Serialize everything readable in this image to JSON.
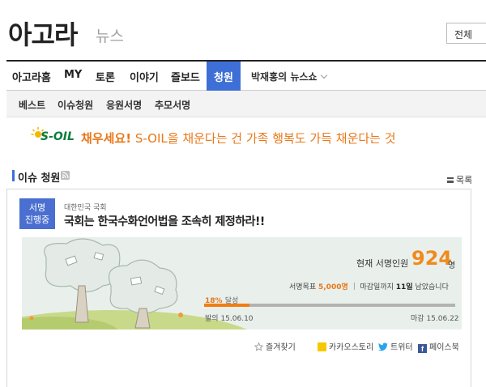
{
  "header": {
    "logo": "아고라",
    "logo_sub": "뉴스",
    "search_scope": "전체"
  },
  "main_nav": {
    "items": [
      {
        "label": "아고라홈"
      },
      {
        "label": "MY"
      },
      {
        "label": "토론"
      },
      {
        "label": "이야기"
      },
      {
        "label": "즐보드"
      },
      {
        "label": "청원",
        "active": true
      }
    ],
    "user_menu": "박재홍의 뉴스쇼"
  },
  "sub_nav": {
    "items": [
      {
        "label": "베스트"
      },
      {
        "label": "이슈청원"
      },
      {
        "label": "응원서명"
      },
      {
        "label": "추모서명"
      }
    ]
  },
  "banner": {
    "brand": "S-OIL",
    "headline": "채우세요!",
    "text": "S-OIL을 채운다는 건 가족 행복도 가득 채운다는 것"
  },
  "section": {
    "title": "이슈 청원",
    "list_button": "목록"
  },
  "petition": {
    "badge_line1": "서명",
    "badge_line2": "진행중",
    "category": "대한민국 국회",
    "title": "국회는 한국수화언어법을 조속히 제정하라!!",
    "current_label": "현재 서명인원",
    "current_count": "924",
    "current_unit": "명",
    "goal_label": "서명목표",
    "goal_value": "5,000명",
    "deadline_prefix": "마감일까지",
    "deadline_days": "11일",
    "deadline_suffix": "남았습니다",
    "progress_label": "18%",
    "progress_suffix": "달성",
    "progress_percent": 18,
    "start_label": "발의",
    "start_date": "15.06.10",
    "end_label": "마감",
    "end_date": "15.06.22"
  },
  "share": {
    "favorite": "즐겨찾기",
    "kakao": "카카오스토리",
    "twitter": "트위터",
    "facebook": "페이스북"
  },
  "colors": {
    "accent": "#3d6fd6",
    "orange": "#f07e12",
    "banner_green": "#0a7e3c"
  }
}
